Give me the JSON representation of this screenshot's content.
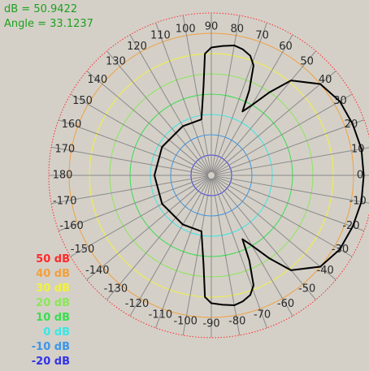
{
  "readout": {
    "db_text": "dB = 50.9422",
    "angle_text": "Angle = 33.1237"
  },
  "chart_data": {
    "type": "polar",
    "radial_unit": "dB",
    "radial_range": [
      -30,
      50
    ],
    "rings": [
      {
        "value": 50,
        "label": "50 dB",
        "color": "#ff2a2a",
        "dotted": true
      },
      {
        "value": 40,
        "label": "40 dB",
        "color": "#f0a040"
      },
      {
        "value": 30,
        "label": "30 dB",
        "color": "#f2f23c"
      },
      {
        "value": 20,
        "label": "20 dB",
        "color": "#8ce65a"
      },
      {
        "value": 10,
        "label": "10 dB",
        "color": "#3cdc50"
      },
      {
        "value": 0,
        "label": "0 dB",
        "color": "#3ce6e6"
      },
      {
        "value": -10,
        "label": "-10 dB",
        "color": "#3c96e6"
      },
      {
        "value": -20,
        "label": "-20 dB",
        "color": "#3232e6"
      }
    ],
    "angle_ticks": [
      "0",
      "10",
      "20",
      "30",
      "40",
      "50",
      "60",
      "70",
      "80",
      "90",
      "100",
      "110",
      "120",
      "130",
      "140",
      "150",
      "160",
      "170",
      "180",
      "-170",
      "-160",
      "-150",
      "-140",
      "-130",
      "-120",
      "-110",
      "-100",
      "-90",
      "-80",
      "-70",
      "-60",
      "-50",
      "-40",
      "-30",
      "-20",
      "-10"
    ],
    "angle_step_deg": 10,
    "grid": true,
    "series": [
      {
        "color": "#000000",
        "points": [
          {
            "angle": 0,
            "db": 45
          },
          {
            "angle": 10,
            "db": 45
          },
          {
            "angle": 20,
            "db": 44
          },
          {
            "angle": 30,
            "db": 43
          },
          {
            "angle": 40,
            "db": 40
          },
          {
            "angle": 50,
            "db": 31
          },
          {
            "angle": 55,
            "db": 20
          },
          {
            "angle": 60,
            "db": 10
          },
          {
            "angle": 64,
            "db": 5
          },
          {
            "angle": 66,
            "db": 16
          },
          {
            "angle": 69,
            "db": 28
          },
          {
            "angle": 72,
            "db": 32
          },
          {
            "angle": 76,
            "db": 34
          },
          {
            "angle": 80,
            "db": 35
          },
          {
            "angle": 85,
            "db": 34
          },
          {
            "angle": 90,
            "db": 33
          },
          {
            "angle": 93,
            "db": 30
          },
          {
            "angle": 95,
            "db": 14
          },
          {
            "angle": 100,
            "db": -2
          },
          {
            "angle": 120,
            "db": -2
          },
          {
            "angle": 150,
            "db": -2
          },
          {
            "angle": 180,
            "db": -2
          },
          {
            "angle": -150,
            "db": -2
          },
          {
            "angle": -120,
            "db": -2
          },
          {
            "angle": -100,
            "db": -2
          },
          {
            "angle": -95,
            "db": 14
          },
          {
            "angle": -93,
            "db": 30
          },
          {
            "angle": -90,
            "db": 33
          },
          {
            "angle": -85,
            "db": 34
          },
          {
            "angle": -80,
            "db": 35
          },
          {
            "angle": -76,
            "db": 34
          },
          {
            "angle": -72,
            "db": 32
          },
          {
            "angle": -69,
            "db": 28
          },
          {
            "angle": -66,
            "db": 16
          },
          {
            "angle": -64,
            "db": 5
          },
          {
            "angle": -60,
            "db": 10
          },
          {
            "angle": -55,
            "db": 20
          },
          {
            "angle": -50,
            "db": 31
          },
          {
            "angle": -40,
            "db": 40
          },
          {
            "angle": -30,
            "db": 43
          },
          {
            "angle": -20,
            "db": 44
          },
          {
            "angle": -10,
            "db": 45
          },
          {
            "angle": 0,
            "db": 45
          }
        ]
      }
    ]
  }
}
